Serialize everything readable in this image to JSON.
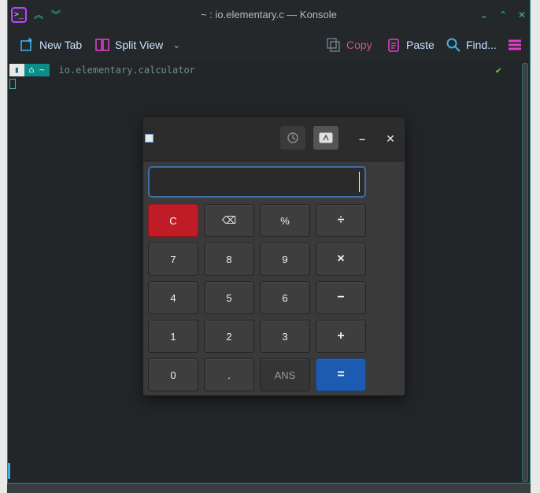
{
  "konsole": {
    "title": "~ : io.elementary.c — Konsole",
    "toolbar": {
      "new_tab": "New Tab",
      "split_view": "Split View",
      "copy": "Copy",
      "paste": "Paste",
      "find": "Find..."
    },
    "prompt": {
      "home_glyph": "~",
      "command": "io.elementary.calculator",
      "status": "✔"
    }
  },
  "calculator": {
    "display_value": "",
    "keys": [
      {
        "label": "C",
        "style": "red"
      },
      {
        "label": "⌫",
        "style": "normal"
      },
      {
        "label": "%",
        "style": "normal"
      },
      {
        "label": "÷",
        "style": "op"
      },
      {
        "label": "7",
        "style": "normal"
      },
      {
        "label": "8",
        "style": "normal"
      },
      {
        "label": "9",
        "style": "normal"
      },
      {
        "label": "×",
        "style": "op"
      },
      {
        "label": "4",
        "style": "normal"
      },
      {
        "label": "5",
        "style": "normal"
      },
      {
        "label": "6",
        "style": "normal"
      },
      {
        "label": "−",
        "style": "op"
      },
      {
        "label": "1",
        "style": "normal"
      },
      {
        "label": "2",
        "style": "normal"
      },
      {
        "label": "3",
        "style": "normal"
      },
      {
        "label": "+",
        "style": "op"
      },
      {
        "label": "0",
        "style": "normal"
      },
      {
        "label": ".",
        "style": "normal"
      },
      {
        "label": "ANS",
        "style": "flat"
      },
      {
        "label": "=",
        "style": "blue"
      }
    ],
    "colors": {
      "clear": "#c01c28",
      "equals": "#1c5bb0",
      "focus_ring": "#3b6fa8"
    }
  }
}
